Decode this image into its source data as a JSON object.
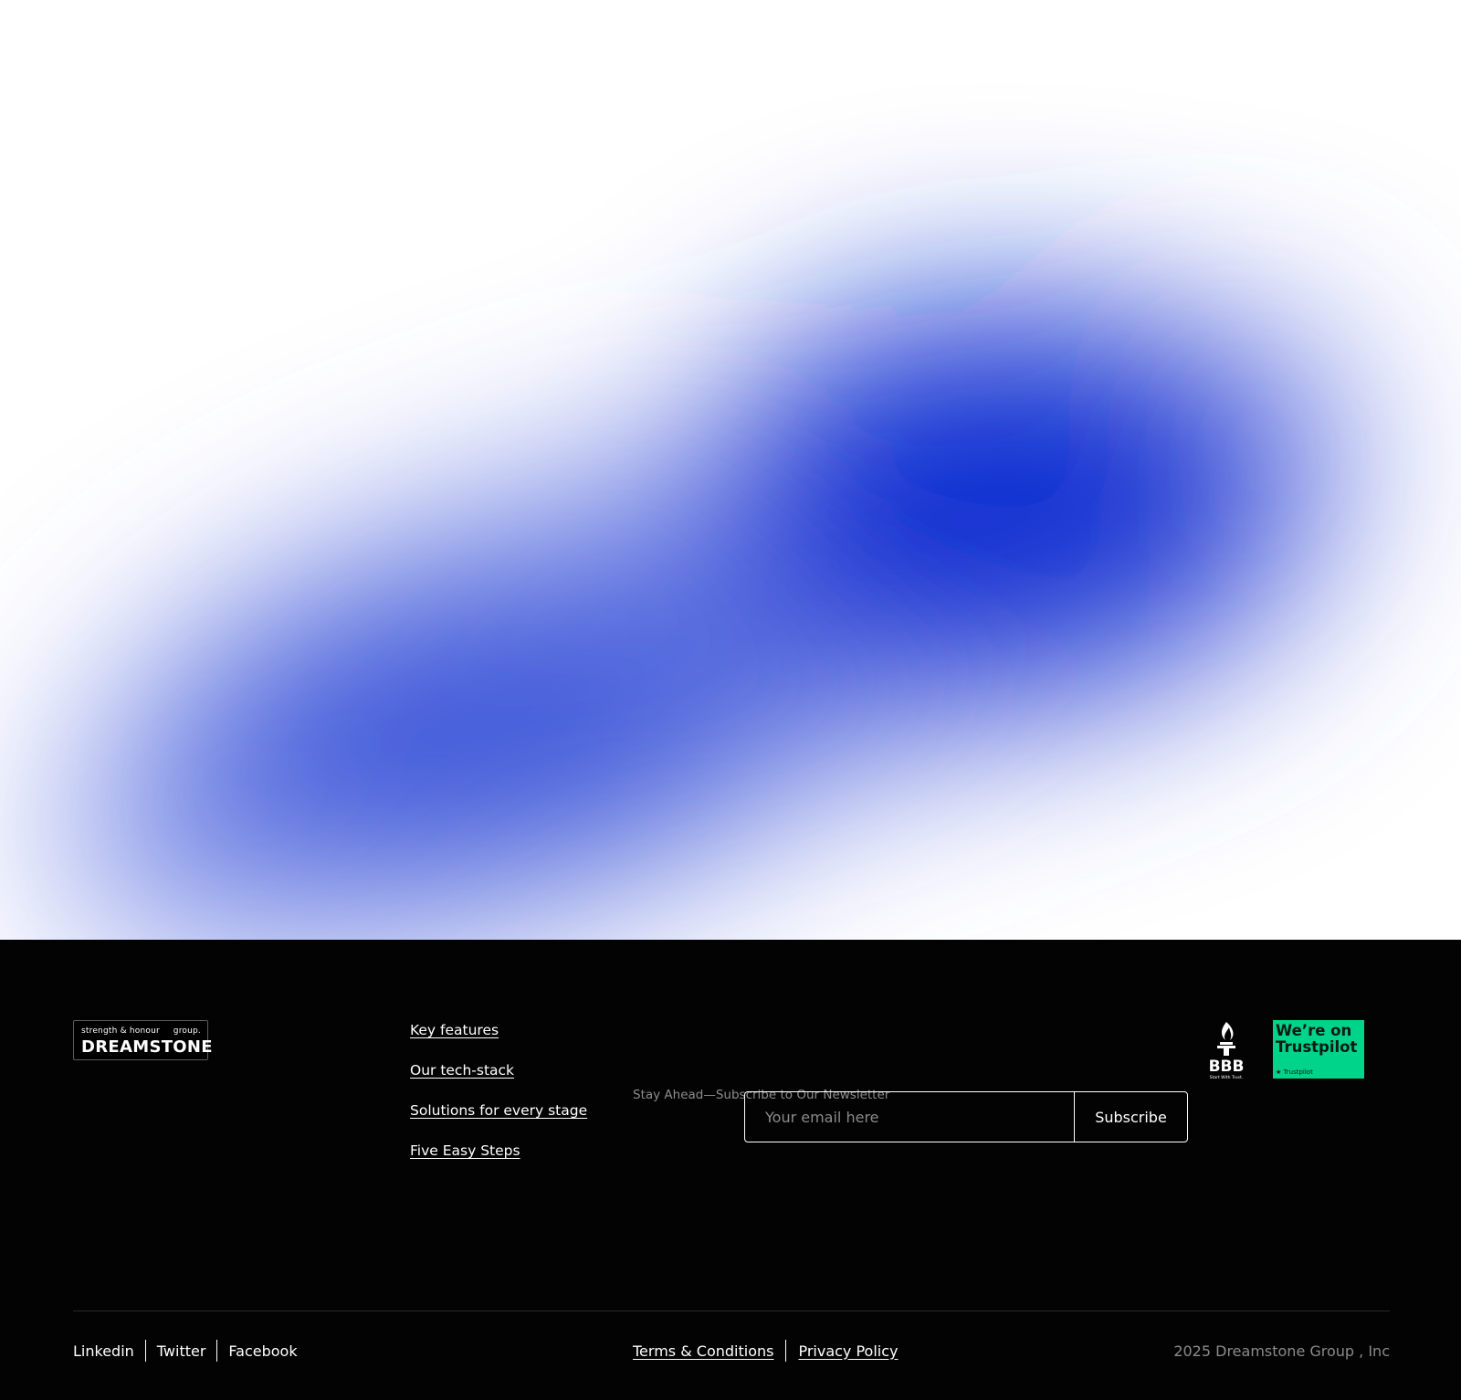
{
  "colors": {
    "blob_core": "#0b2ed1",
    "blob_mid": "#3f5ad8",
    "footer_bg": "#030303",
    "trustpilot_green": "#00d38a",
    "muted_text": "#8a8a8a"
  },
  "logo": {
    "tagline_left": "strength & honour",
    "tagline_right": "group.",
    "wordmark": "DREAMSTONE"
  },
  "nav": {
    "items": [
      {
        "label": "Key features"
      },
      {
        "label": "Our tech-stack"
      },
      {
        "label": "Solutions for every stage"
      },
      {
        "label": "Five Easy Steps"
      }
    ]
  },
  "newsletter": {
    "label": "Stay Ahead—Subscribe to Our Newsletter",
    "placeholder": "Your email here",
    "button_label": "Subscribe"
  },
  "badges": {
    "bbb": {
      "icon": "bbb-torch-icon",
      "text": "BBB",
      "subtext": "Start With Trust."
    },
    "trustpilot": {
      "title": "We’re on Trustpilot",
      "subtext": "Trustpilot"
    }
  },
  "social": {
    "links": [
      {
        "label": "Linkedin"
      },
      {
        "label": "Twitter"
      },
      {
        "label": "Facebook"
      }
    ]
  },
  "legal": {
    "terms": "Terms & Conditions",
    "privacy": "Privacy Policy"
  },
  "copyright": "2025 Dreamstone Group , Inc"
}
